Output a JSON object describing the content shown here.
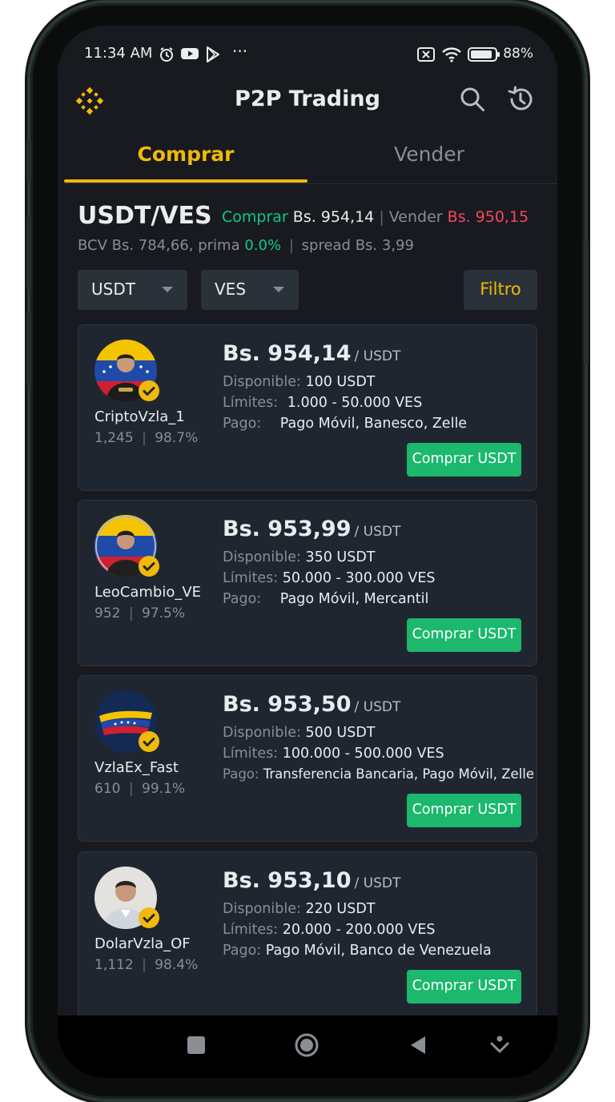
{
  "status": {
    "time": "11:34 AM",
    "dots": "···",
    "battery": "88%"
  },
  "header": {
    "title": "P2P Trading"
  },
  "tabs": [
    {
      "label": "Comprar"
    },
    {
      "label": "Vender"
    }
  ],
  "pair": {
    "name": "USDT/VES",
    "buy_label": "Comprar",
    "buy_price": "Bs. 954,14",
    "separator": "|",
    "sell_label": "Vender",
    "sell_price": "Bs. 950,15",
    "bcv_text": "BCV Bs. 784,66, prima",
    "prima_value": "0.0%",
    "spread_text": "spread Bs. 3,99"
  },
  "filters": {
    "asset": "USDT",
    "fiat": "VES",
    "filter_label": "Filtro"
  },
  "labels": {
    "available": "Disponible:",
    "limits": "Límites:",
    "payment": "Pago:",
    "unit": "/ USDT",
    "stats_sep": "|",
    "buy_button": "Comprar USDT"
  },
  "offers": [
    {
      "name": "CriptoVzla_1",
      "orders": "1,245",
      "completion": "98.7%",
      "price": "Bs. 954,14",
      "available": "100 USDT",
      "limits": "1.000 - 50.000 VES",
      "payment": "Pago Móvil, Banesco, Zelle"
    },
    {
      "name": "LeoCambio_VE",
      "orders": "952",
      "completion": "97.5%",
      "price": "Bs. 953,99",
      "available": "350 USDT",
      "limits": "50.000 - 300.000 VES",
      "payment": "Pago Móvil, Mercantil"
    },
    {
      "name": "VzlaEx_Fast",
      "orders": "610",
      "completion": "99.1%",
      "price": "Bs. 953,50",
      "available": "500 USDT",
      "limits": "100.000 - 500.000 VES",
      "payment": "Transferencia Bancaria, Pago Móvil, Zelle"
    },
    {
      "name": "DolarVzla_OF",
      "orders": "1,112",
      "completion": "98.4%",
      "price": "Bs. 953,10",
      "available": "220 USDT",
      "limits": "20.000 - 200.000 VES",
      "payment": "Pago Móvil, Banco de Venezuela"
    }
  ],
  "icons": {
    "logo": "binance-logo-icon",
    "search": "search-icon",
    "history": "history-icon",
    "verified": "verified-check-icon",
    "nav": [
      "recent-apps-icon",
      "home-icon",
      "back-icon",
      "assistant-icon"
    ]
  },
  "colors": {
    "accent": "#f0b90b",
    "buy": "#0ecb81",
    "sell": "#f6465d",
    "button": "#1bb86d",
    "card": "#202630",
    "bg": "#181a20"
  }
}
